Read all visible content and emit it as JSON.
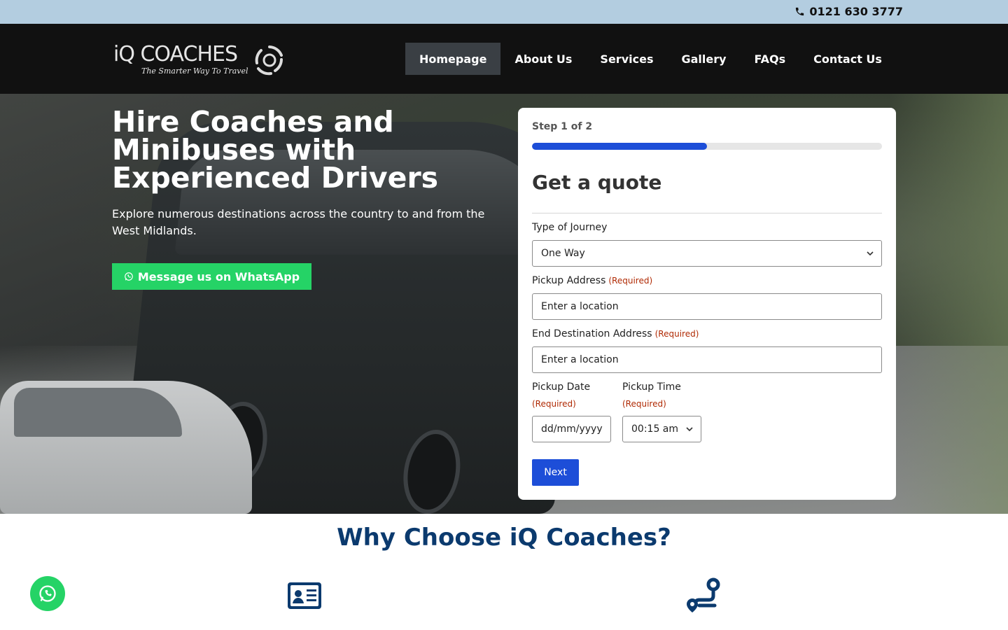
{
  "topbar": {
    "phone": "0121 630 3777"
  },
  "brand": {
    "name": "iQ COACHES",
    "tagline": "The Smarter Way To Travel"
  },
  "nav": {
    "items": [
      {
        "label": "Homepage",
        "active": true
      },
      {
        "label": "About Us"
      },
      {
        "label": "Services"
      },
      {
        "label": "Gallery"
      },
      {
        "label": "FAQs"
      },
      {
        "label": "Contact Us"
      }
    ]
  },
  "hero": {
    "title": "Hire Coaches and Minibuses with Experienced Drivers",
    "subtitle": "Explore numerous destinations across the country to and from the West Midlands.",
    "whatsapp_label": "Message us on WhatsApp"
  },
  "quote_form": {
    "step_label": "Step 1 of 2",
    "progress_fraction": 0.5,
    "title": "Get a quote",
    "journey_type": {
      "label": "Type of Journey",
      "value": "One Way"
    },
    "pickup_address": {
      "label": "Pickup Address",
      "required": "(Required)",
      "placeholder": "Enter a location"
    },
    "end_address": {
      "label": "End Destination Address",
      "required": "(Required)",
      "placeholder": "Enter a location"
    },
    "pickup_date": {
      "label": "Pickup Date",
      "required": "(Required)",
      "placeholder": "dd/mm/yyyy"
    },
    "pickup_time": {
      "label": "Pickup Time",
      "required": "(Required)",
      "value": "00:15 am"
    },
    "next_label": "Next"
  },
  "why": {
    "title": "Why Choose iQ Coaches?"
  },
  "colors": {
    "accent": "#1d4ed8",
    "whatsapp": "#25d366",
    "heading": "#0b3a6e",
    "topbar": "#b3cde0",
    "header": "#111111"
  }
}
